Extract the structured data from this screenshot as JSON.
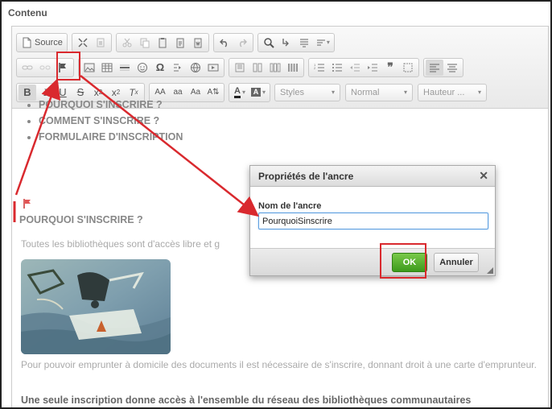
{
  "section_label": "Contenu",
  "toolbar": {
    "source_label": "Source",
    "styles_label": "Styles",
    "format_label": "Normal",
    "size_label": "Hauteur ..."
  },
  "content": {
    "toc": [
      "POURQUOI S'INSCRIRE ?",
      "COMMENT S'INSCRIRE ?",
      "FORMULAIRE D'INSCRIPTION"
    ],
    "heading": "POURQUOI S'INSCRIRE ?",
    "para1": "Toutes les bibliothèques sont d'accès libre et g",
    "para2": "Pour pouvoir emprunter à domicile des documents il est nécessaire de s'inscrire, donnant droit à une carte d'emprunteur.",
    "para3": "Une seule inscription donne accès à l'ensemble du réseau des bibliothèques communautaires"
  },
  "dialog": {
    "title": "Propriétés de l'ancre",
    "field_label": "Nom de l'ancre",
    "field_value": "PourquoiSinscrire",
    "ok_label": "OK",
    "cancel_label": "Annuler"
  },
  "colors": {
    "highlight": "#d9292e",
    "ok_green": "#3d9a1c",
    "input_focus": "#5fa0e0"
  }
}
